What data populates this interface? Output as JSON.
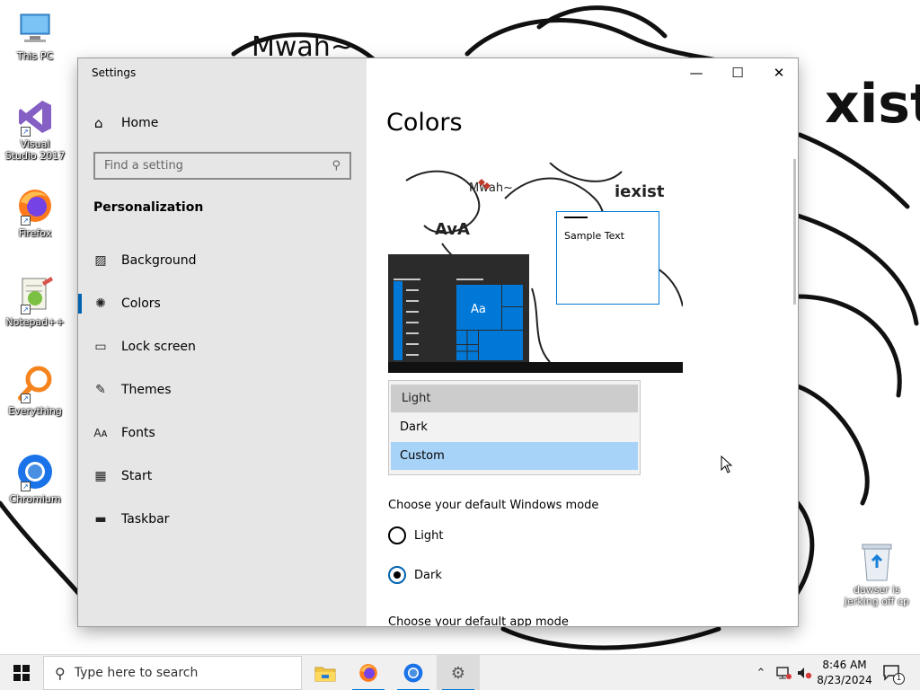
{
  "desktop": {
    "icons": [
      {
        "label": "This PC"
      },
      {
        "label": "Visual Studio 2017"
      },
      {
        "label": "Firefox"
      },
      {
        "label": "Notepad++"
      },
      {
        "label": "Everything"
      },
      {
        "label": "Chromium"
      }
    ],
    "recycle_bin_label": "dawser is jerking off cp",
    "wallpaper_text": {
      "top_right": "xist",
      "scribble": "Mwah~"
    }
  },
  "window": {
    "title": "Settings",
    "controls": {
      "minimize": "—",
      "maximize": "☐",
      "close": "✕"
    }
  },
  "nav": {
    "home_label": "Home",
    "search_placeholder": "Find a setting",
    "section_title": "Personalization",
    "items": [
      {
        "label": "Background",
        "icon": "image-icon",
        "active": false
      },
      {
        "label": "Colors",
        "icon": "palette-icon",
        "active": true
      },
      {
        "label": "Lock screen",
        "icon": "lock-screen-icon",
        "active": false
      },
      {
        "label": "Themes",
        "icon": "themes-icon",
        "active": false
      },
      {
        "label": "Fonts",
        "icon": "fonts-icon",
        "active": false
      },
      {
        "label": "Start",
        "icon": "start-icon",
        "active": false
      },
      {
        "label": "Taskbar",
        "icon": "taskbar-icon",
        "active": false
      }
    ]
  },
  "content": {
    "page_title": "Colors",
    "preview": {
      "sample_text": "Sample Text",
      "tile_label": "Aa",
      "wallpaper_text_1": "Mwah~",
      "wallpaper_text_2": "iexist",
      "wallpaper_text_3": "AvA"
    },
    "dropdown": {
      "options": [
        "Light",
        "Dark",
        "Custom"
      ],
      "hovered": "Light",
      "selected": "Custom"
    },
    "windows_mode": {
      "label": "Choose your default Windows mode",
      "options": [
        {
          "label": "Light",
          "checked": false
        },
        {
          "label": "Dark",
          "checked": true
        }
      ]
    },
    "app_mode_label": "Choose your default app mode"
  },
  "taskbar": {
    "search_placeholder": "Type here to search",
    "clock_time": "8:46 AM",
    "clock_date": "8/23/2024",
    "notification_count": "1"
  },
  "colors": {
    "accent": "#0078d7",
    "nav_bg": "#e6e6e6",
    "dropdown_selected": "#a8d3f8"
  }
}
